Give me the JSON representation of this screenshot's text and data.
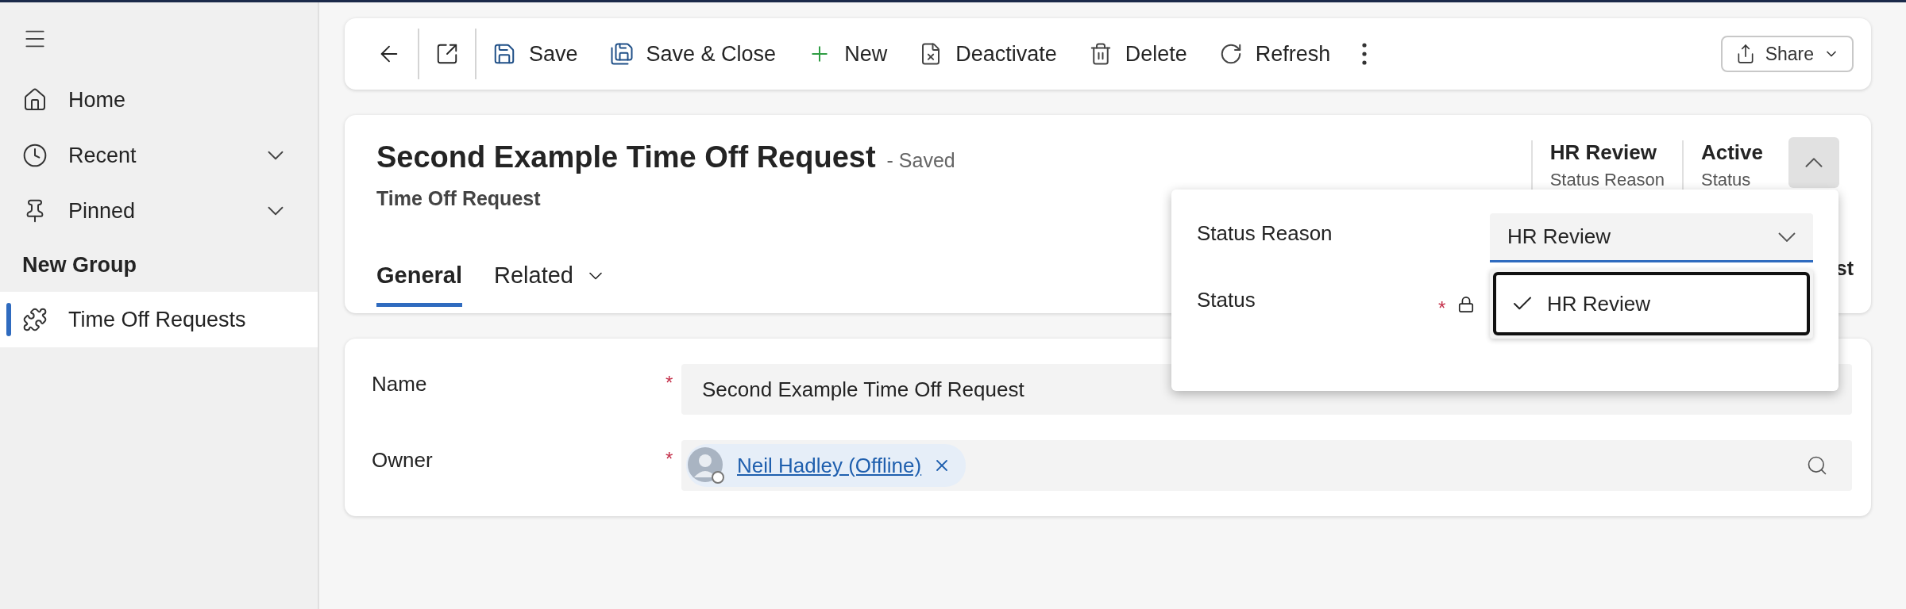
{
  "sidebar": {
    "items": [
      {
        "label": "Home",
        "kind": "link"
      },
      {
        "label": "Recent",
        "kind": "expandable"
      },
      {
        "label": "Pinned",
        "kind": "expandable"
      }
    ],
    "group": {
      "title": "New Group",
      "items": [
        {
          "label": "Time Off Requests",
          "selected": true
        }
      ]
    }
  },
  "toolbar": {
    "commands": [
      {
        "label": "Save"
      },
      {
        "label": "Save & Close"
      },
      {
        "label": "New"
      },
      {
        "label": "Deactivate"
      },
      {
        "label": "Delete"
      },
      {
        "label": "Refresh"
      }
    ],
    "share": {
      "label": "Share"
    }
  },
  "record": {
    "title": "Second Example Time Off Request",
    "save_state": "- Saved",
    "entity": "Time Off Request",
    "tabs": [
      {
        "label": "General",
        "selected": true,
        "kind": "plain"
      },
      {
        "label": "Related",
        "selected": false,
        "kind": "menu"
      }
    ],
    "header_fields": [
      {
        "value": "HR Review",
        "label": "Status Reason"
      },
      {
        "value": "Active",
        "label": "Status"
      }
    ],
    "header_expanded": true,
    "covered_text": "st"
  },
  "flyout": {
    "fields": [
      {
        "label": "Status Reason",
        "kind": "dropdown",
        "value": "HR Review",
        "options": [
          {
            "label": "HR Review",
            "selected": true
          }
        ]
      },
      {
        "label": "Status",
        "kind": "locked",
        "required_mark": "*"
      }
    ]
  },
  "form": {
    "fields": [
      {
        "label": "Name",
        "kind": "text",
        "required_mark": "*",
        "value": "Second Example Time Off Request"
      },
      {
        "label": "Owner",
        "kind": "lookup",
        "required_mark": "*",
        "value": "Neil Hadley (Offline)"
      }
    ]
  }
}
